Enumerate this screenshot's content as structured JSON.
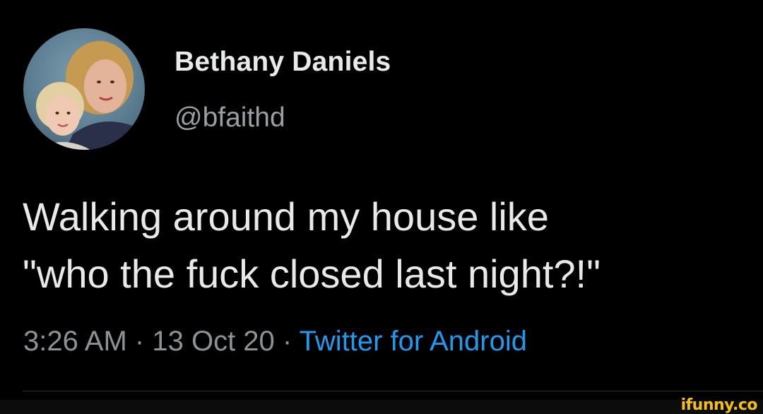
{
  "author": {
    "display_name": "Bethany Daniels",
    "handle": "@bfaithd",
    "avatar_icon": "profile-photo"
  },
  "tweet": {
    "lines": [
      "Walking around my house like",
      "\"who the fuck closed last night?!\""
    ],
    "time": "3:26 AM",
    "separator": "·",
    "date": "13 Oct 20",
    "source": "Twitter for Android"
  },
  "watermark": {
    "text": "ifunny.co"
  },
  "colors": {
    "background": "#000000",
    "text": "#e7e9ea",
    "secondary_text": "#8d9296",
    "link": "#1d9bf0",
    "watermark": "#f5c10c"
  }
}
